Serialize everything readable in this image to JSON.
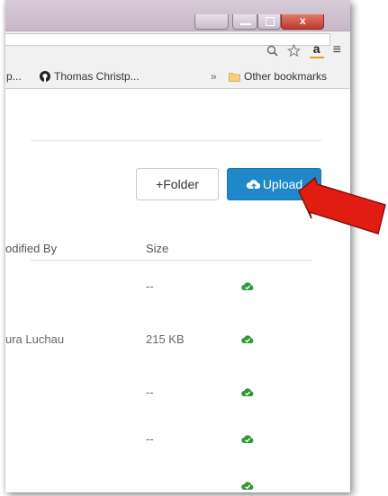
{
  "browser": {
    "toolbar_icons": [
      "zoom-icon",
      "star-icon",
      "amazon-icon",
      "menu-icon"
    ],
    "amazon_glyph": "a",
    "menu_glyph": "≡",
    "bookmarks": {
      "item1": "p...",
      "item2": "Thomas Christp...",
      "overflow": "»",
      "other": "Other bookmarks"
    }
  },
  "toolbar": {
    "folder_label": "+Folder",
    "upload_label": "Upload"
  },
  "table": {
    "headers": {
      "modified_by": "odified By",
      "size": "Size"
    },
    "rows": [
      {
        "modified_by": "",
        "size": "--",
        "status": "synced"
      },
      {
        "modified_by": "ura Luchau",
        "size": "215 KB",
        "status": "synced"
      },
      {
        "modified_by": "",
        "size": "--",
        "status": "synced"
      },
      {
        "modified_by": "",
        "size": "--",
        "status": "synced"
      },
      {
        "modified_by": "",
        "size": "",
        "status": "synced"
      }
    ]
  },
  "colors": {
    "accent": "#1e88c8",
    "status_ok": "#2f9a35",
    "arrow": "#e11d12"
  }
}
